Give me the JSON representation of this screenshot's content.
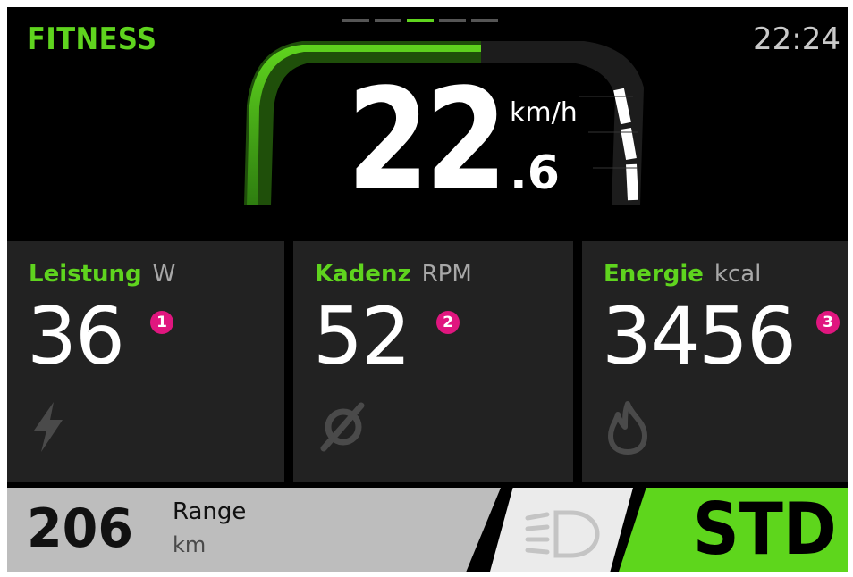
{
  "header": {
    "mode_title": "FITNESS",
    "clock": "22:24",
    "page_indicator": {
      "count": 5,
      "active_index": 2
    }
  },
  "speed": {
    "integer": "22",
    "decimal": ".6",
    "unit": "km/h"
  },
  "metrics": [
    {
      "label": "Leistung",
      "unit": "W",
      "value": "36",
      "badge": "1",
      "icon": "lightning-icon"
    },
    {
      "label": "Kadenz",
      "unit": "RPM",
      "value": "52",
      "badge": "2",
      "icon": "cadence-crank-icon"
    },
    {
      "label": "Energie",
      "unit": "kcal",
      "value": "3456",
      "badge": "3",
      "icon": "flame-icon"
    }
  ],
  "bottom_bar": {
    "range_value": "206",
    "range_label": "Range",
    "range_unit": "km",
    "light_icon": "headlight-icon",
    "assist_mode": "STD"
  },
  "colors": {
    "accent_green": "#5fd41e",
    "badge_magenta": "#e0167f",
    "panel_bg": "#222222",
    "range_bg": "#bdbdbd",
    "assist_bg": "#5ed61c"
  }
}
